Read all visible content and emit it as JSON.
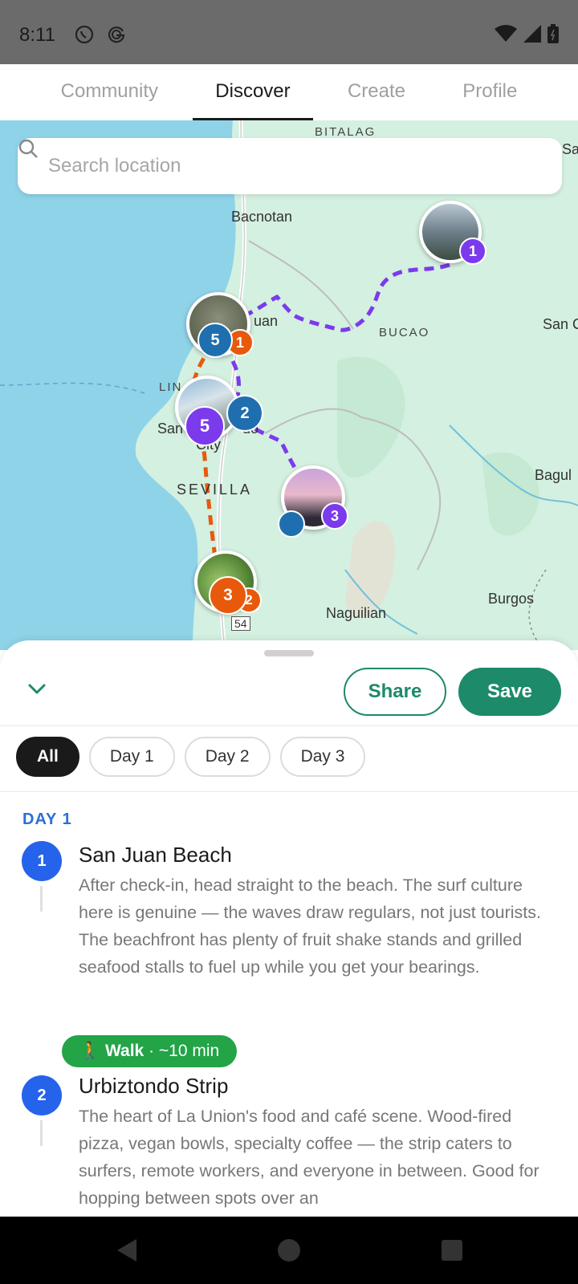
{
  "status_bar": {
    "time": "8:11",
    "app_icons": [
      "whatsapp-icon",
      "google-icon"
    ],
    "system_icons": [
      "wifi-icon",
      "signal-icon",
      "battery-icon"
    ]
  },
  "tabs": [
    {
      "label": "Community",
      "active": false
    },
    {
      "label": "Discover",
      "active": true
    },
    {
      "label": "Create",
      "active": false
    },
    {
      "label": "Profile",
      "active": false
    }
  ],
  "search": {
    "placeholder": "Search location"
  },
  "map": {
    "labels": {
      "bitalag": "BITALAG",
      "sa": "Sa",
      "bacnotan": "Bacnotan",
      "juan": "uan",
      "bucao": "BUCAO",
      "san_c": "San C",
      "lin": "LIN",
      "san": "San",
      "oo": "do",
      "city": "City",
      "sevilla": "SEVILLA",
      "bagul": "Bagul",
      "burgos": "Burgos",
      "naguilian": "Naguilian",
      "road_54": "54"
    },
    "markers": [
      {
        "count": "1",
        "color": "#7c3aed"
      },
      {
        "count": "5",
        "color": "#1f6fb0",
        "second_count": "1",
        "second_color": "#e8590c"
      },
      {
        "count": "5",
        "color": "#7c3aed",
        "second_count": "2",
        "second_color": "#1f6fb0"
      },
      {
        "count": "3",
        "color": "#7c3aed"
      },
      {
        "count": "3",
        "color": "#e8590c",
        "second_count": "2",
        "second_color": "#e8590c"
      }
    ]
  },
  "sheet": {
    "share_label": "Share",
    "save_label": "Save",
    "filters": [
      {
        "label": "All",
        "active": true
      },
      {
        "label": "Day 1",
        "active": false
      },
      {
        "label": "Day 2",
        "active": false
      },
      {
        "label": "Day 3",
        "active": false
      }
    ],
    "day_heading": "DAY 1",
    "stops": [
      {
        "number": "1",
        "title": "San Juan Beach",
        "description": "After check-in, head straight to the beach. The surf culture here is genuine — the waves draw regulars, not just tourists. The beachfront has plenty of fruit shake stands and grilled seafood stalls to fuel up while you get your bearings."
      },
      {
        "number": "2",
        "title": "Urbiztondo Strip",
        "description": "The heart of La Union's food and café scene. Wood-fired pizza, vegan bowls, specialty coffee — the strip caters to surfers, remote workers, and everyone in between. Good for hopping between spots over an"
      }
    ],
    "transit": {
      "icon": "🚶",
      "mode": "Walk",
      "duration": "· ~10 min"
    }
  },
  "colors": {
    "accent": "#1d8a6a",
    "day_blue": "#2563eb",
    "walk_green": "#22a447",
    "route_purple": "#7c3aed",
    "route_orange": "#e8590c"
  }
}
